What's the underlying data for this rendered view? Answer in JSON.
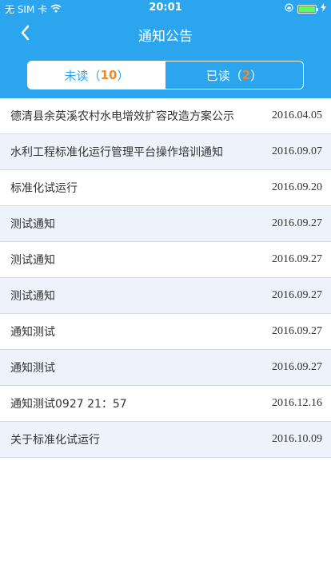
{
  "status_bar": {
    "carrier": "无 SIM 卡",
    "time": "20:01"
  },
  "nav": {
    "title": "通知公告",
    "back_icon": "chevron-left-icon"
  },
  "tabs": {
    "unread_label": "未读（",
    "unread_count": "10",
    "unread_suffix": "）",
    "read_label": "已读（",
    "read_count": "2",
    "read_suffix": "）",
    "active": "unread"
  },
  "colors": {
    "primary": "#2aa5ee",
    "count_accent": "#f08a24",
    "row_alt": "#eef3fb"
  },
  "notices": [
    {
      "title": "德清县余英溪农村水电增效扩容改造方案公示",
      "date": "2016.04.05"
    },
    {
      "title": "水利工程标准化运行管理平台操作培训通知",
      "date": "2016.09.07"
    },
    {
      "title": "标准化试运行",
      "date": "2016.09.20"
    },
    {
      "title": "测试通知",
      "date": "2016.09.27"
    },
    {
      "title": "测试通知",
      "date": "2016.09.27"
    },
    {
      "title": "测试通知",
      "date": "2016.09.27"
    },
    {
      "title": "通知测试",
      "date": "2016.09.27"
    },
    {
      "title": "通知测试",
      "date": "2016.09.27"
    },
    {
      "title": "通知测试0927 21：57",
      "date": "2016.12.16"
    },
    {
      "title": "关于标准化试运行",
      "date": "2016.10.09"
    }
  ]
}
